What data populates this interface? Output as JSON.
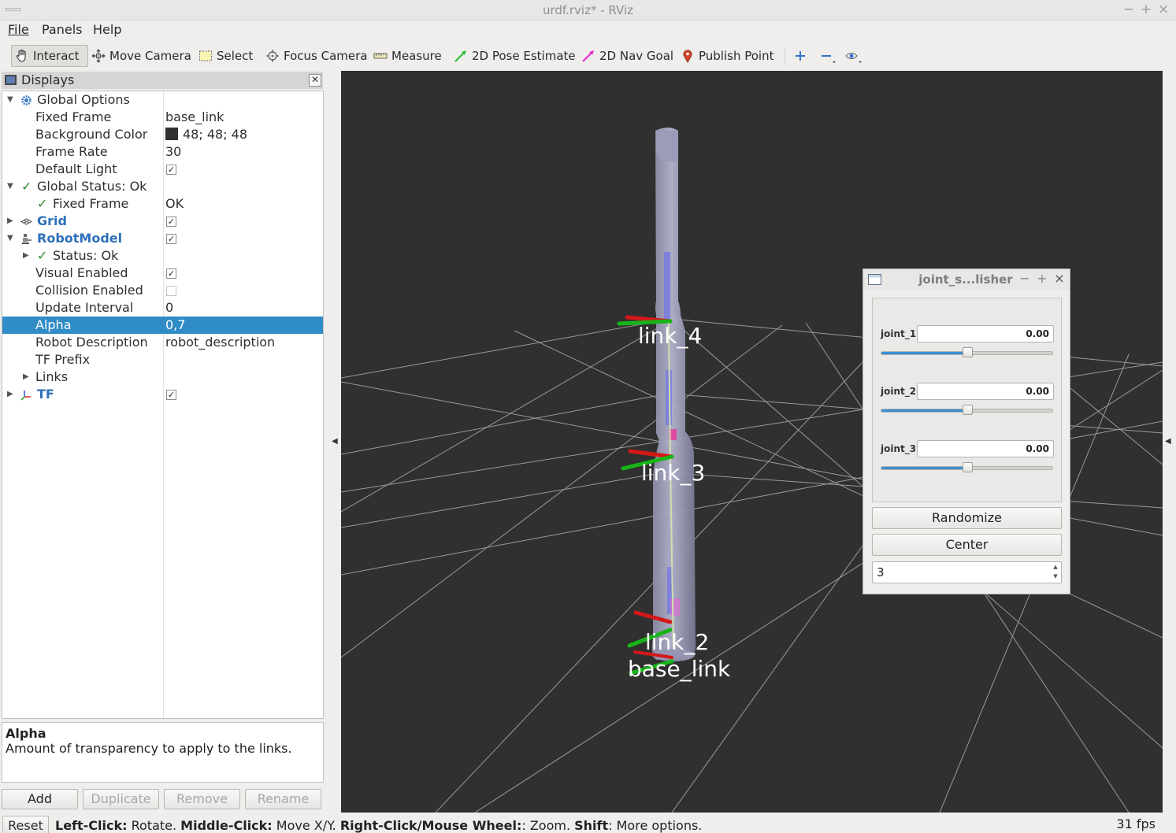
{
  "window": {
    "title": "urdf.rviz* - RViz",
    "buttons": [
      "−",
      "+",
      "×"
    ]
  },
  "menu": [
    "File",
    "Panels",
    "Help"
  ],
  "toolbar": {
    "tools": [
      {
        "label": "Interact",
        "icon": "hand-icon",
        "active": true
      },
      {
        "label": "Move Camera",
        "icon": "move-camera-icon"
      },
      {
        "label": "Select",
        "icon": "select-icon"
      },
      {
        "label": "Focus Camera",
        "icon": "focus-camera-icon"
      },
      {
        "label": "Measure",
        "icon": "ruler-icon"
      },
      {
        "label": "2D Pose Estimate",
        "icon": "green-arrow-icon"
      },
      {
        "label": "2D Nav Goal",
        "icon": "magenta-arrow-icon"
      },
      {
        "label": "Publish Point",
        "icon": "map-pin-icon"
      }
    ],
    "extra_icons": [
      "plus-icon",
      "minus-icon",
      "eye-icon"
    ]
  },
  "displays": {
    "title": "Displays",
    "tree": [
      {
        "label": "Global Options",
        "value": "",
        "bold": false
      },
      {
        "label": "Fixed Frame",
        "value": "base_link"
      },
      {
        "label": "Background Color",
        "value": "48; 48; 48"
      },
      {
        "label": "Frame Rate",
        "value": "30"
      },
      {
        "label": "Default Light",
        "value": "✓"
      },
      {
        "label": "Global Status: Ok",
        "value": ""
      },
      {
        "label": "Fixed Frame",
        "value": "OK"
      },
      {
        "label": "Grid",
        "value": "✓"
      },
      {
        "label": "RobotModel",
        "value": "✓"
      },
      {
        "label": "Status: Ok",
        "value": ""
      },
      {
        "label": "Visual Enabled",
        "value": "✓"
      },
      {
        "label": "Collision Enabled",
        "value": ""
      },
      {
        "label": "Update Interval",
        "value": "0"
      },
      {
        "label": "Alpha",
        "value": "0,7"
      },
      {
        "label": "Robot Description",
        "value": "robot_description"
      },
      {
        "label": "TF Prefix",
        "value": ""
      },
      {
        "label": "Links",
        "value": ""
      },
      {
        "label": "TF",
        "value": "✓"
      }
    ],
    "description": {
      "title": "Alpha",
      "text": "Amount of transparency to apply to the links."
    },
    "buttons": [
      "Add",
      "Duplicate",
      "Remove",
      "Rename"
    ]
  },
  "view": {
    "background": "#303030",
    "labels": [
      "link_4",
      "link_3",
      "link_2",
      "base_link"
    ]
  },
  "joint_panel": {
    "title": "joint_s...lisher",
    "joints": [
      {
        "name": "joint_1",
        "value": "0.00",
        "slider": 0.5
      },
      {
        "name": "joint_2",
        "value": "0.00",
        "slider": 0.5
      },
      {
        "name": "joint_3",
        "value": "0.00",
        "slider": 0.5
      }
    ],
    "randomize": "Randomize",
    "center": "Center",
    "spin_value": "3"
  },
  "status": {
    "reset": "Reset",
    "help_parts": [
      {
        "b": "Left-Click:",
        "t": " Rotate. "
      },
      {
        "b": "Middle-Click:",
        "t": " Move X/Y. "
      },
      {
        "b": "Right-Click/Mouse Wheel:",
        "t": ": Zoom. "
      },
      {
        "b": "Shift",
        "t": ": More options."
      }
    ],
    "fps": "31 fps"
  }
}
